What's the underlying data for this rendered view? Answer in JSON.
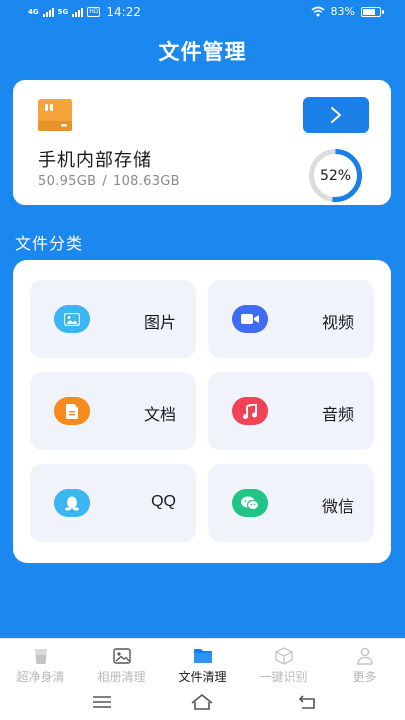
{
  "status_bar": {
    "signal_1": "4G",
    "signal_2": "5G",
    "hd_badge": "HD",
    "time": "14:22",
    "battery_text": "83%",
    "battery_level": 0.83
  },
  "header": {
    "title": "文件管理"
  },
  "storage": {
    "name": "手机内部存储",
    "used": "50.95GB",
    "separator": "/",
    "total": "108.63GB",
    "percent_text": "52%",
    "percent": 52,
    "icon": "sd-card-icon",
    "open_icon": "chevron-right-icon"
  },
  "categories_title": "文件分类",
  "categories": [
    {
      "label": "图片",
      "icon": "image-icon",
      "color": "#3bb6f0"
    },
    {
      "label": "视频",
      "icon": "video-camera-icon",
      "color": "#3f6cf0"
    },
    {
      "label": "文档",
      "icon": "document-icon",
      "color": "#f78a1c"
    },
    {
      "label": "音频",
      "icon": "music-note-icon",
      "color": "#f04356"
    },
    {
      "label": "QQ",
      "icon": "qq-penguin-icon",
      "color": "#3bb6f0"
    },
    {
      "label": "微信",
      "icon": "wechat-icon",
      "color": "#21c487"
    }
  ],
  "bottom_nav": {
    "items": [
      {
        "label": "超净身清",
        "icon": "cup-icon",
        "active": false
      },
      {
        "label": "相册清理",
        "icon": "photo-album-icon",
        "active": false
      },
      {
        "label": "文件清理",
        "icon": "folder-icon",
        "active": true
      },
      {
        "label": "一键识别",
        "icon": "box-scan-icon",
        "active": false
      },
      {
        "label": "更多",
        "icon": "user-icon",
        "active": false
      }
    ]
  },
  "colors": {
    "primary": "#1b88ef",
    "button": "#1b7fe8",
    "tile_bg": "#f1f3fa",
    "sd_card": "#f5a43a"
  }
}
